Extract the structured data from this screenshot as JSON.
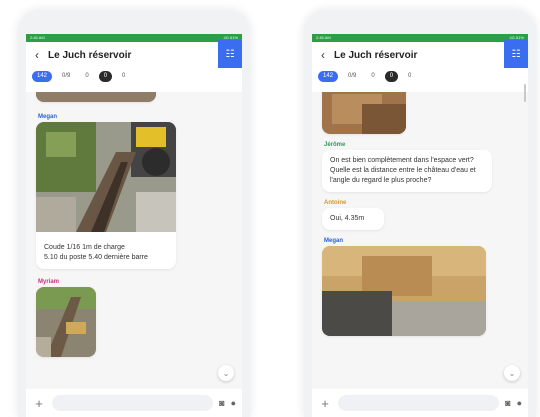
{
  "status": {
    "left": "2:45 AM",
    "right": "4G  61%"
  },
  "header": {
    "title": "Le Juch réservoir"
  },
  "chips": [
    "142",
    "0/9",
    "0",
    "0",
    "0"
  ],
  "left_chat": {
    "author_megan": "Megan",
    "caption_line1": "Coude 1/16 1m de charge",
    "caption_line2": "5.10 du poste 5.40 dernière barre",
    "author_myriam": "Myriam"
  },
  "right_chat": {
    "author_jerome": "Jérôme",
    "question": "On est bien complètement dans l'espace vert? Quelle est la distance entre le château d'eau et l'angle du regard le plus proche?",
    "author_antoine": "Antoine",
    "answer": "Oui, 4.35m",
    "author_megan": "Megan"
  },
  "colors": {
    "accent": "#3a6df0",
    "status": "#2e9e44"
  }
}
